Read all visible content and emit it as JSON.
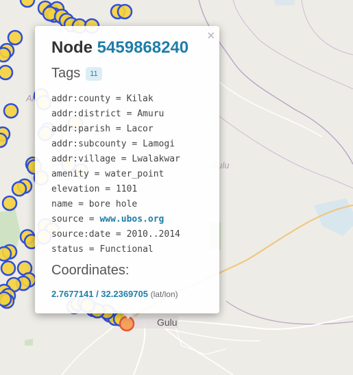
{
  "map": {
    "labels": {
      "gulu_city": "Gulu",
      "gulu_region": "Gulu",
      "amuru_region": "Amu"
    }
  },
  "popup": {
    "close_label": "×",
    "title_prefix": "Node",
    "node_id": "5459868240",
    "tags_heading": "Tags",
    "tag_count": "11",
    "tags": [
      {
        "key": "addr:county",
        "value": "Kilak"
      },
      {
        "key": "addr:district",
        "value": "Amuru"
      },
      {
        "key": "addr:parish",
        "value": "Lacor"
      },
      {
        "key": "addr:subcounty",
        "value": "Lamogi"
      },
      {
        "key": "addr:village",
        "value": "Lwalakwar"
      },
      {
        "key": "amenity",
        "value": "water_point"
      },
      {
        "key": "elevation",
        "value": "1101"
      },
      {
        "key": "name",
        "value": "bore hole"
      },
      {
        "key": "source",
        "value": "www.ubos.org"
      },
      {
        "key": "source:date",
        "value": "2010..2014"
      },
      {
        "key": "status",
        "value": "Functional"
      }
    ],
    "coordinates_heading": "Coordinates:",
    "lat": "2.7677141",
    "separator": " / ",
    "lon": "32.2369705",
    "unit": "(lat/lon)"
  },
  "colors": {
    "marker_fill": "#f5d33c",
    "marker_stroke": "#2f4fd8",
    "selected_marker_fill": "#f5a25c",
    "selected_marker_stroke": "#e6563a",
    "link": "#1f7ea8"
  }
}
